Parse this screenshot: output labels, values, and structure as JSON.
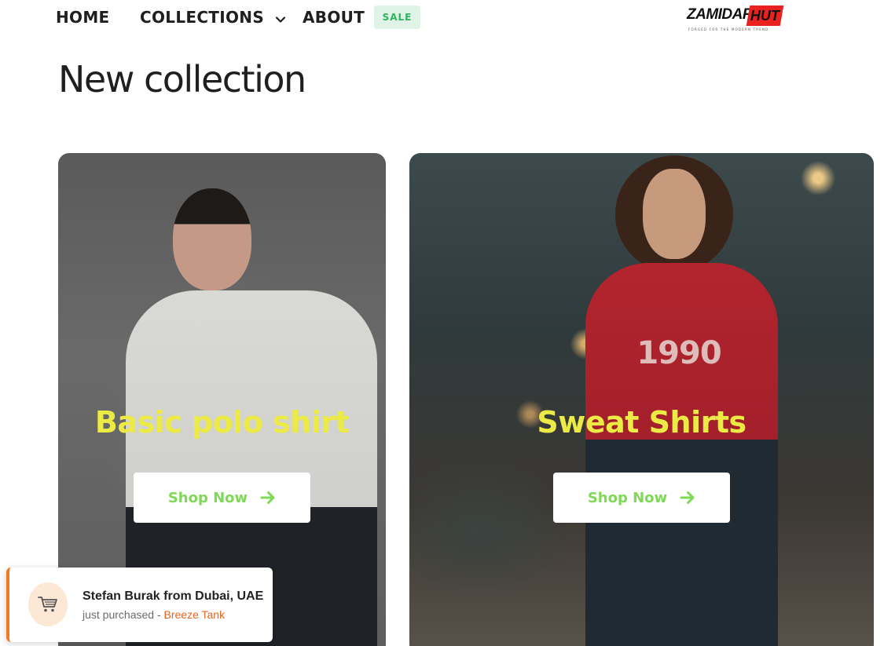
{
  "nav": {
    "home_label": "HOME",
    "collections_label": "COLLECTIONS",
    "about_label": "ABOUT",
    "sale_badge": "SALE"
  },
  "logo": {
    "word1": "ZAMIDAR",
    "word2": "HUT",
    "tagline": "FORGED FOR THE MODERN TREND"
  },
  "section": {
    "title": "New collection"
  },
  "cards": [
    {
      "title": "Basic polo shirt",
      "button_label": "Shop Now"
    },
    {
      "title": "Sweat Shirts",
      "button_label": "Shop Now",
      "print_text": "1990"
    }
  ],
  "notification": {
    "title": "Stefan Burak from Dubai, UAE",
    "subtitle_prefix": "just purchased - ",
    "product": "Breeze Tank"
  },
  "colors": {
    "accent_green": "#7ed957",
    "title_yellow": "#ecea45",
    "notification_orange": "#e8631c",
    "logo_red": "#e8231f"
  },
  "icons": [
    "chevron-down-icon",
    "arrow-right-icon",
    "shopping-cart-icon"
  ]
}
